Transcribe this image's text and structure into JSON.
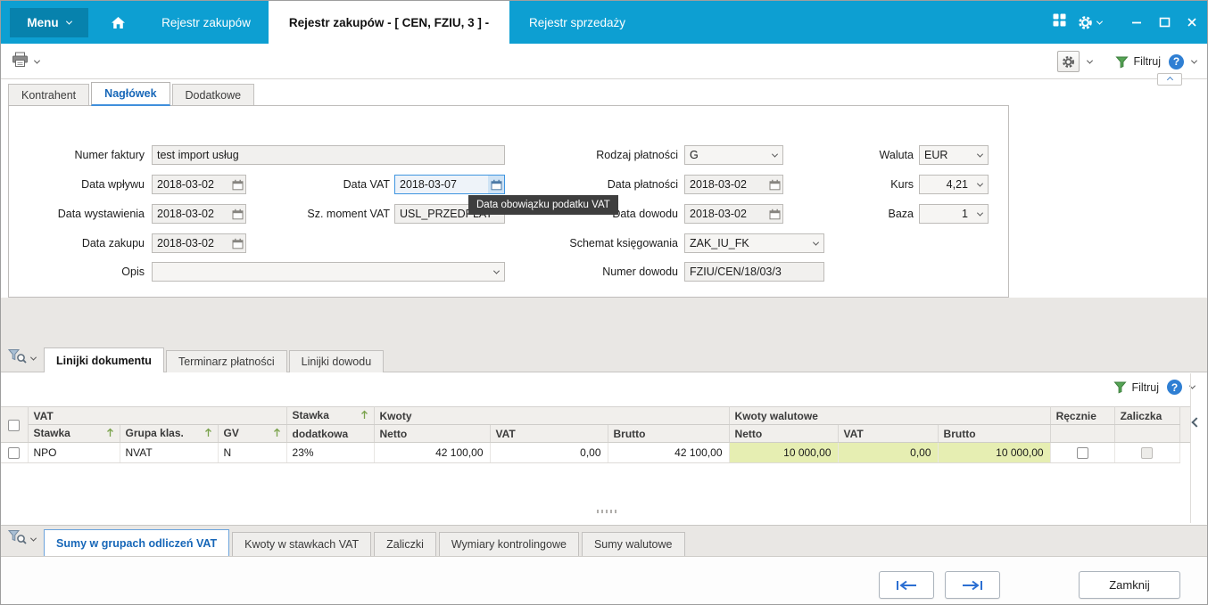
{
  "colors": {
    "titlebar_teal": "#0d9fd2",
    "menu_dark": "#0782ad",
    "active_tab_text_blue": "#1767b8",
    "help_blue": "#2f7fd3",
    "filter_green": "#55a455",
    "highlight_yellow": "#e6eeb2",
    "tooltip_bg": "#3e3e3e",
    "focus_border": "#3f95e0"
  },
  "titlebar": {
    "menu": "Menu",
    "window_tabs": [
      {
        "label": "Rejestr zakupów"
      },
      {
        "label": "Rejestr zakupów - [ CEN, FZIU, 3 ] -"
      },
      {
        "label": "Rejestr sprzedaży"
      }
    ]
  },
  "toolbar": {
    "filtruj": "Filtruj",
    "help": "?"
  },
  "header_form": {
    "tabs": [
      {
        "label": "Kontrahent"
      },
      {
        "label": "Nagłówek"
      },
      {
        "label": "Dodatkowe"
      }
    ],
    "numer_faktury_label": "Numer faktury",
    "numer_faktury_value": "test import usług",
    "data_wplywu_label": "Data wpływu",
    "data_wplywu_value": "2018-03-02",
    "data_wystawienia_label": "Data wystawienia",
    "data_wystawienia_value": "2018-03-02",
    "data_zakupu_label": "Data zakupu",
    "data_zakupu_value": "2018-03-02",
    "opis_label": "Opis",
    "opis_value": "",
    "data_vat_label": "Data VAT",
    "data_vat_value": "2018-03-07",
    "sz_moment_vat_label": "Sz. moment VAT",
    "sz_moment_vat_value": "USL_PRZEDPŁAT",
    "tooltip": "Data obowiązku podatku VAT",
    "rodzaj_platnosci_label": "Rodzaj płatności",
    "rodzaj_platnosci_value": "G",
    "data_platnosci_label": "Data płatności",
    "data_platnosci_value": "2018-03-02",
    "data_dowodu_label": "Data dowodu",
    "data_dowodu_value": "2018-03-02",
    "schemat_label": "Schemat księgowania",
    "schemat_value": "ZAK_IU_FK",
    "numer_dowodu_label": "Numer dowodu",
    "numer_dowodu_value": "FZIU/CEN/18/03/3",
    "waluta_label": "Waluta",
    "waluta_value": "EUR",
    "kurs_label": "Kurs",
    "kurs_value": "4,21",
    "baza_label": "Baza",
    "baza_value": "1"
  },
  "lines": {
    "tabs": [
      {
        "label": "Linijki dokumentu"
      },
      {
        "label": "Terminarz płatności"
      },
      {
        "label": "Linijki dowodu"
      }
    ],
    "filtruj": "Filtruj",
    "help": "?",
    "table": {
      "groups": {
        "vat": "VAT",
        "stawka_dodatkowa_l1": "Stawka",
        "stawka_dodatkowa_l2": "dodatkowa",
        "kwoty": "Kwoty",
        "kwoty_walutowe": "Kwoty walutowe",
        "recznie": "Ręcznie",
        "zaliczka": "Zaliczka"
      },
      "columns": {
        "stawka": "Stawka",
        "grupa_klas": "Grupa klas.",
        "gv": "GV",
        "netto": "Netto",
        "vat": "VAT",
        "brutto": "Brutto",
        "netto_wal": "Netto",
        "vat_wal": "VAT",
        "brutto_wal": "Brutto"
      },
      "rows": [
        {
          "stawka": "NPO",
          "grupa_klas": "NVAT",
          "gv": "N",
          "stawka_dodatkowa": "23%",
          "netto": "42 100,00",
          "vat": "0,00",
          "brutto": "42 100,00",
          "netto_wal": "10 000,00",
          "vat_wal": "0,00",
          "brutto_wal": "10 000,00"
        }
      ]
    }
  },
  "summary": {
    "tabs": [
      {
        "label": "Sumy w grupach odliczeń VAT"
      },
      {
        "label": "Kwoty w stawkach VAT"
      },
      {
        "label": "Zaliczki"
      },
      {
        "label": "Wymiary kontrolingowe"
      },
      {
        "label": "Sumy walutowe"
      }
    ]
  },
  "footer": {
    "zamknij": "Zamknij"
  }
}
